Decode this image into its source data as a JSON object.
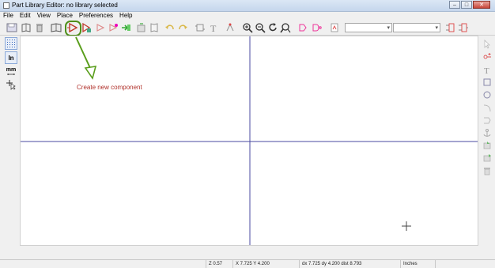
{
  "window": {
    "title": "Part Library Editor: no library selected",
    "buttons": {
      "minimize": "–",
      "maximize": "□",
      "close": "✕"
    }
  },
  "menu": {
    "items": [
      "File",
      "Edit",
      "View",
      "Place",
      "Preferences",
      "Help"
    ]
  },
  "toolbar": {
    "combo_part_value": "",
    "combo_unit_value": "",
    "highlighted_tool": "new-component-icon"
  },
  "left_toolbar": {
    "units_inch_label": "In",
    "units_mm_label": "mm"
  },
  "annotation": {
    "label": "Create new component",
    "color": "#b0302a",
    "arrow_color": "#5a9e1c"
  },
  "canvas": {
    "background": "#ffffff",
    "axis_color": "#4a4aa0"
  },
  "status": {
    "zoom": "Z 0.57",
    "cursor": "X 7.725  Y 4.200",
    "delta": "dx 7.725  dy 4.200  dist 8.793",
    "units": "Inches"
  },
  "colors": {
    "accent_red": "#b0302a",
    "accent_green": "#5a9e1c",
    "titlebar": "#dbe7f5"
  }
}
